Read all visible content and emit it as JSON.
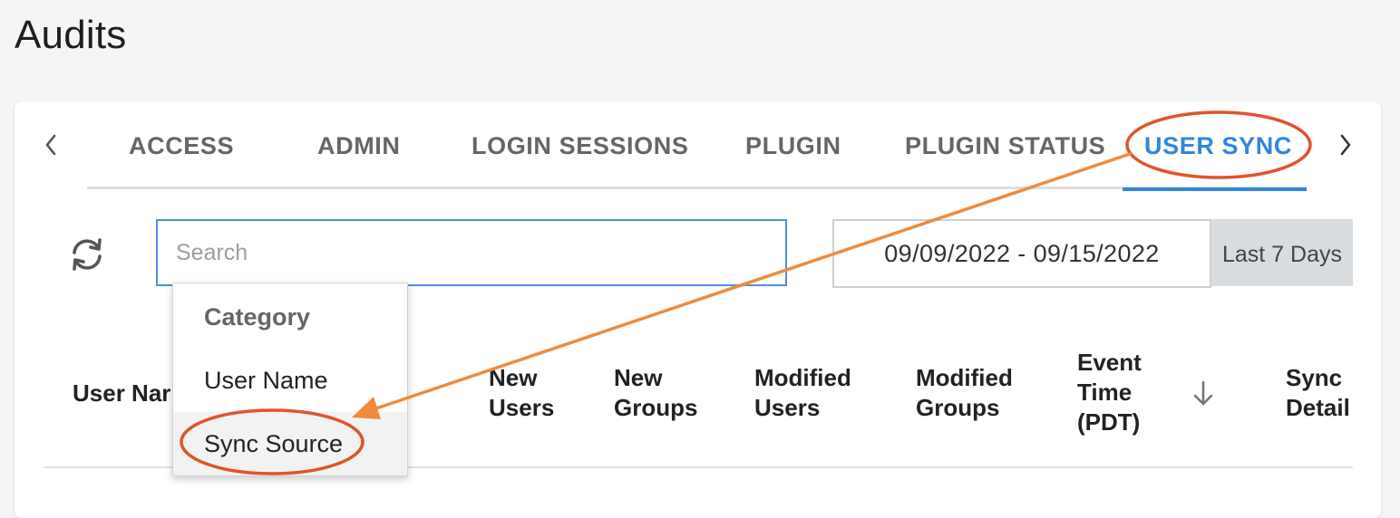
{
  "page": {
    "title": "Audits"
  },
  "tabs": [
    {
      "label": "ACCESS",
      "active": false
    },
    {
      "label": "ADMIN",
      "active": false
    },
    {
      "label": "LOGIN SESSIONS",
      "active": false
    },
    {
      "label": "PLUGIN",
      "active": false
    },
    {
      "label": "PLUGIN STATUS",
      "active": false
    },
    {
      "label": "USER SYNC",
      "active": true
    }
  ],
  "toolbar": {
    "refresh_icon": "refresh-icon",
    "search_placeholder": "Search",
    "search_value": "",
    "date_range": "09/09/2022 - 09/15/2022",
    "preset_range": "Last 7 Days"
  },
  "dropdown": {
    "header": "Category",
    "items": [
      "User Name",
      "Sync Source"
    ],
    "highlighted": "Sync Source"
  },
  "table": {
    "columns": [
      {
        "line1": "User Nar"
      },
      {
        "line1": "New",
        "line2": "Users"
      },
      {
        "line1": "New",
        "line2": "Groups"
      },
      {
        "line1": "Modified",
        "line2": "Users"
      },
      {
        "line1": "Modified",
        "line2": "Groups"
      },
      {
        "line1": "Event",
        "line2": "Time",
        "line3": "(PDT)"
      },
      {
        "line1": "Sync",
        "line2": "Detail"
      }
    ],
    "sort_icon": "arrow-down-icon"
  },
  "colors": {
    "accent": "#2f86e0",
    "annotation": "#f08a3c",
    "annotation_ellipse": "#e0542b"
  }
}
